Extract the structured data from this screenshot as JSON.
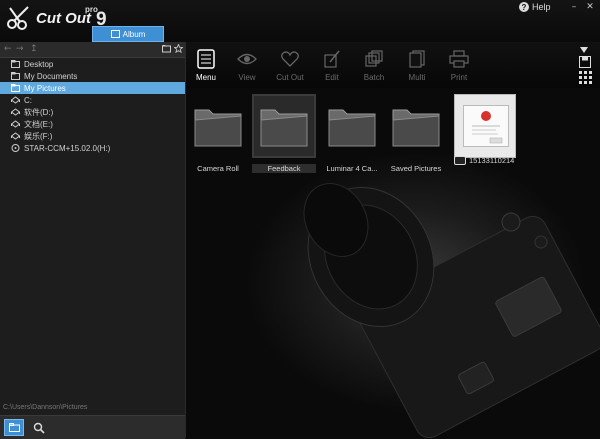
{
  "app": {
    "logo_text": "Cut Out",
    "logo_pro": "pro",
    "logo_version": "9"
  },
  "titlebar": {
    "album_tab": "Album",
    "help_label": "Help",
    "minimize_glyph": "–",
    "close_glyph": "✕"
  },
  "sidebar": {
    "items": [
      {
        "label": "Desktop",
        "icon": "folder-icon"
      },
      {
        "label": "My Documents",
        "icon": "folder-icon"
      },
      {
        "label": "My Pictures",
        "icon": "folder-icon",
        "selected": true
      },
      {
        "label": "C:",
        "icon": "drive-icon"
      },
      {
        "label": "软件(D:)",
        "icon": "drive-icon"
      },
      {
        "label": "文档(E:)",
        "icon": "drive-icon"
      },
      {
        "label": "娱乐(F:)",
        "icon": "drive-icon"
      },
      {
        "label": "STAR-CCM+15.02.0(H:)",
        "icon": "disc-icon"
      }
    ],
    "path": "C:\\Users\\Dannson\\Pictures"
  },
  "toolbar": {
    "menu": "Menu",
    "view": "View",
    "cutout": "Cut Out",
    "edit": "Edit",
    "batch": "Batch",
    "multi": "Multi",
    "print": "Print"
  },
  "thumbs": [
    {
      "label": "Camera Roll"
    },
    {
      "label": "Feedback",
      "selected": true
    },
    {
      "label": "Luminar 4 Ca..."
    },
    {
      "label": "Saved Pictures"
    }
  ],
  "photo": {
    "label": "15133110214"
  },
  "colors": {
    "accent": "#3f8fd4",
    "selection": "#5fa9de"
  }
}
